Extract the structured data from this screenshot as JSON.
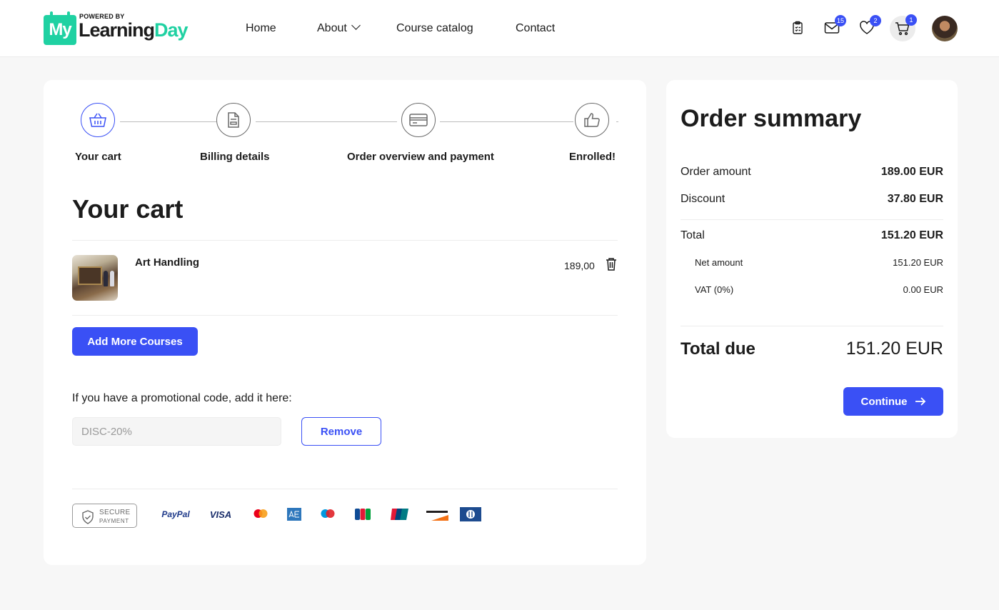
{
  "header": {
    "logo": {
      "powered_by": "POWERED BY",
      "box_text": "My",
      "word_part1": "Learning",
      "word_part2": "Day"
    },
    "nav": [
      {
        "label": "Home"
      },
      {
        "label": "About"
      },
      {
        "label": "Course catalog"
      },
      {
        "label": "Contact"
      }
    ],
    "icons": {
      "messages_count": "15",
      "wishlist_count": "2",
      "cart_count": "1"
    }
  },
  "stepper": {
    "steps": [
      {
        "label": "Your cart",
        "icon": "basket-icon",
        "active": true
      },
      {
        "label": "Billing details",
        "icon": "document-icon",
        "active": false
      },
      {
        "label": "Order overview and payment",
        "icon": "credit-card-icon",
        "active": false
      },
      {
        "label": "Enrolled!",
        "icon": "thumbs-up-icon",
        "active": false
      }
    ]
  },
  "cart": {
    "title": "Your cart",
    "items": [
      {
        "name": "Art Handling",
        "price": "189,00"
      }
    ],
    "add_more_label": "Add More Courses",
    "promo_label": "If you have a promotional code, add it here:",
    "promo_value": "DISC-20%",
    "remove_label": "Remove",
    "secure": {
      "line1": "SECURE",
      "line2": "PAYMENT"
    },
    "payment_methods": [
      "PayPal",
      "VISA",
      "Mastercard",
      "American Express",
      "Maestro",
      "JCB",
      "UnionPay",
      "DISCOVER",
      "Diners Club"
    ]
  },
  "summary": {
    "title": "Order summary",
    "order_amount_label": "Order amount",
    "order_amount_value": "189.00 EUR",
    "discount_label": "Discount",
    "discount_value": "37.80 EUR",
    "total_label": "Total",
    "total_value": "151.20 EUR",
    "net_label": "Net amount",
    "net_value": "151.20 EUR",
    "vat_label": "VAT (0%)",
    "vat_value": "0.00 EUR",
    "total_due_label": "Total due",
    "total_due_value": "151.20 EUR",
    "continue_label": "Continue"
  },
  "colors": {
    "primary": "#3a50f5",
    "brand_green": "#1fd1a2",
    "background": "#f7f7f7"
  }
}
